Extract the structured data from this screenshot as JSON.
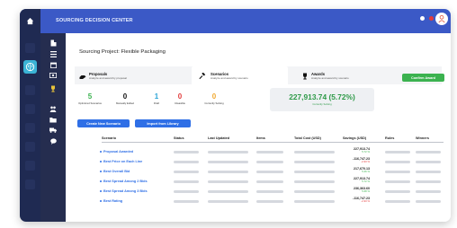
{
  "header": {
    "app_title": "SOURCING DECISION CENTER",
    "dot_colors": [
      "#ffffff",
      "#e23a3a"
    ]
  },
  "page": {
    "title": "Sourcing Project: Flexible Packaging"
  },
  "tabs": [
    {
      "label": "Proposals",
      "sub": "Analyze and award by proposal",
      "icon": "hand-icon"
    },
    {
      "label": "Scenarios",
      "sub": "Analyze and award by scenario",
      "icon": "gavel-icon"
    },
    {
      "label": "Awards",
      "sub": "Analyze and award by scenario",
      "icon": "trophy-icon"
    }
  ],
  "confirm_label": "Confirm Award",
  "stats": [
    {
      "value": "5",
      "label": "Optimized Scenarios",
      "color": "#3bb24f"
    },
    {
      "value": "0",
      "label": "Manually Edited",
      "color": "#111111"
    },
    {
      "value": "1",
      "label": "Draft",
      "color": "#2aa4d6"
    },
    {
      "value": "0",
      "label": "Infeasible",
      "color": "#e23a3a"
    },
    {
      "value": "0",
      "label": "Currently Solving",
      "color": "#f0a830"
    }
  ],
  "highlight": {
    "value": "227,913.74 (5.72%)",
    "label": "Currently Solving"
  },
  "buttons": {
    "create": "Create New Scenario",
    "import": "Import from Library"
  },
  "table": {
    "columns": [
      "Scenario",
      "Status",
      "Last Updated",
      "Items",
      "Total Cost (USD)",
      "Savings (USD)",
      "Rules",
      "Winners"
    ],
    "rows": [
      {
        "name": "Proposal Awarded",
        "savings": "227,913.74",
        "pct": "5.72 %",
        "pct_color": "#3bb24f"
      },
      {
        "name": "Best Price on Each Line",
        "savings": "-116,747.23",
        "pct": "-2.93 %",
        "pct_color": "#e23a3a"
      },
      {
        "name": "Best Overall Bid",
        "savings": "217,670.13",
        "pct": "5.46 %",
        "pct_color": "#3bb24f"
      },
      {
        "name": "Best Spread Among 2 Bids",
        "savings": "227,913.74",
        "pct": "5.72 %",
        "pct_color": "#3bb24f"
      },
      {
        "name": "Best Spread Among 3 Bids",
        "savings": "236,363.60",
        "pct": "5.68 %",
        "pct_color": "#3bb24f"
      },
      {
        "name": "Best Rating",
        "savings": "-116,747.23",
        "pct": "-2.93 %",
        "pct_color": "#e23a3a"
      }
    ]
  }
}
